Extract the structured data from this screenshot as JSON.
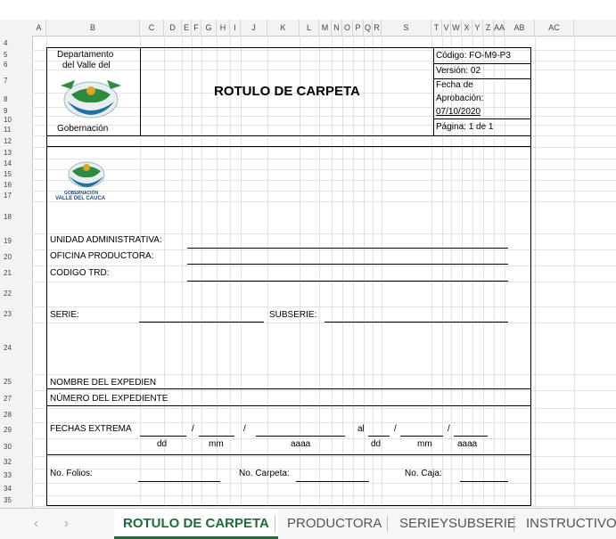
{
  "sheet": {
    "columns": [
      "A",
      "B",
      "C",
      "D",
      "E",
      "F",
      "G",
      "H",
      "I",
      "J",
      "K",
      "L",
      "M",
      "N",
      "O",
      "P",
      "Q",
      "R",
      "S",
      "T",
      "V",
      "W",
      "X",
      "Y",
      "Z",
      "AA",
      "AB",
      "AC"
    ],
    "rows": [
      "4",
      "5",
      "6",
      "7",
      "8",
      "9",
      "10",
      "11",
      "12",
      "13",
      "14",
      "15",
      "16",
      "17",
      "18",
      "19",
      "20",
      "21",
      "22",
      "23",
      "24",
      "25",
      "27",
      "28",
      "29",
      "30",
      "32",
      "33",
      "34",
      "35"
    ]
  },
  "header": {
    "dept_line1": "Departamento",
    "dept_line2": "del Valle del",
    "gobernacion": "Gobernación",
    "title": "ROTULO DE CARPETA",
    "codigo": "Código: FO-M9-P3",
    "version": "Versión: 02",
    "fecha_l1": "Fecha de",
    "fecha_l2": "Aprobación:",
    "fecha_l3": "07/10/2020",
    "pagina": "Página: 1 de 1"
  },
  "logo": {
    "line1": "GOBERNACIÓN",
    "line2": "VALLE DEL CAUCA"
  },
  "form": {
    "unidad": "UNIDAD ADMINISTRATIVA:",
    "oficina": "OFICINA PRODUCTORA:",
    "codigo_trd": "CODIGO TRD:",
    "serie": "SERIE:",
    "subserie": "SUBSERIE:",
    "nombre_exp": "NOMBRE DEL EXPEDIEN",
    "numero_exp": "NÚMERO DEL EXPEDIENTE",
    "fechas": "FECHAS EXTREMA",
    "slash": "/",
    "al": "al",
    "dd": "dd",
    "mm": "mm",
    "aaaa": "aaaa",
    "folios": "No. Folios:",
    "carpeta": "No. Carpeta:",
    "caja": "No. Caja:"
  },
  "tabs": {
    "prev": "‹",
    "next": "›",
    "t1": "ROTULO DE CARPETA",
    "t2": "PRODUCTORA",
    "t3": "SERIEYSUBSERIE",
    "t4": "INSTRUCTIVO"
  }
}
